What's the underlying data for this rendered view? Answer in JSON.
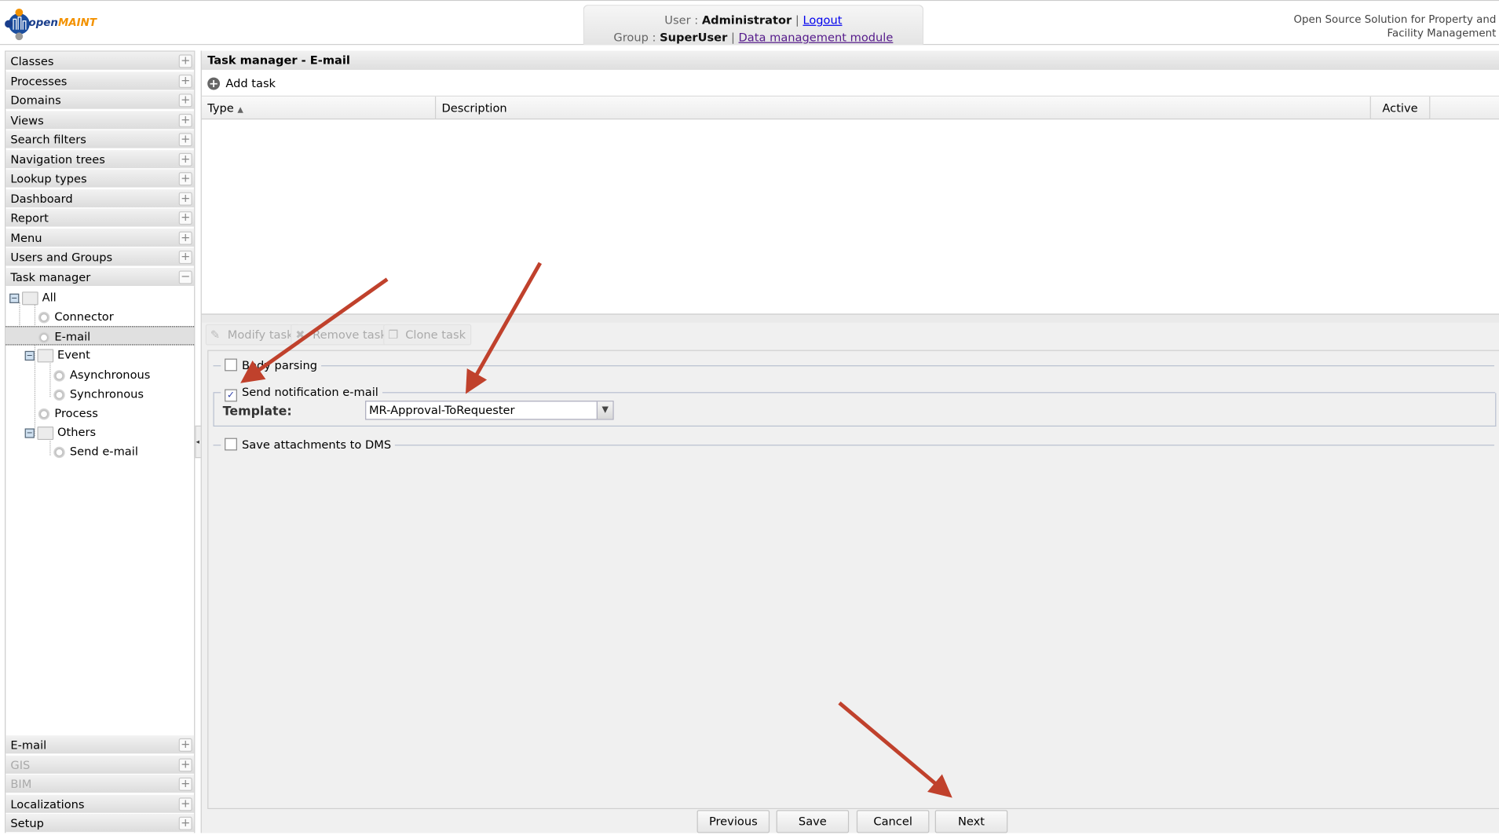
{
  "header": {
    "logo_text": "openMAINT",
    "user_label": "User :",
    "user_name": "Administrator",
    "logout": "Logout",
    "group_label": "Group :",
    "group_name": "SuperUser",
    "module_link": "Data management module",
    "separator": "|",
    "tagline_line1": "Open Source Solution for Property and",
    "tagline_line2": "Facility Management"
  },
  "sidebar": {
    "top_sections": [
      {
        "label": "Classes",
        "toggle": "+"
      },
      {
        "label": "Processes",
        "toggle": "+"
      },
      {
        "label": "Domains",
        "toggle": "+"
      },
      {
        "label": "Views",
        "toggle": "+"
      },
      {
        "label": "Search filters",
        "toggle": "+"
      },
      {
        "label": "Navigation trees",
        "toggle": "+"
      },
      {
        "label": "Lookup types",
        "toggle": "+"
      },
      {
        "label": "Dashboard",
        "toggle": "+"
      },
      {
        "label": "Report",
        "toggle": "+"
      },
      {
        "label": "Menu",
        "toggle": "+"
      },
      {
        "label": "Users and Groups",
        "toggle": "+"
      },
      {
        "label": "Task manager",
        "toggle": "−"
      }
    ],
    "tree": [
      {
        "label": "All"
      },
      {
        "label": "Connector"
      },
      {
        "label": "E-mail"
      },
      {
        "label": "Event"
      },
      {
        "label": "Asynchronous"
      },
      {
        "label": "Synchronous"
      },
      {
        "label": "Process"
      },
      {
        "label": "Others"
      },
      {
        "label": "Send e-mail"
      }
    ],
    "bottom_sections": [
      {
        "label": "E-mail",
        "toggle": "+"
      },
      {
        "label": "GIS",
        "toggle": "+"
      },
      {
        "label": "BIM",
        "toggle": "+"
      },
      {
        "label": "Localizations",
        "toggle": "+"
      },
      {
        "label": "Setup",
        "toggle": "+"
      }
    ]
  },
  "main": {
    "title": "Task manager - E-mail",
    "add_task": "Add task",
    "columns": {
      "type": "Type",
      "sort_indicator": "▲",
      "description": "Description",
      "active": "Active"
    },
    "toolbar": {
      "modify": "Modify task",
      "remove": "Remove task",
      "clone": "Clone task"
    },
    "form": {
      "body_parsing": "Body parsing",
      "body_parsing_checked": false,
      "send_notification": "Send notification e-mail",
      "send_notification_checked": true,
      "template_label": "Template:",
      "template_value": "MR-Approval-ToRequester",
      "save_attachments": "Save attachments to DMS",
      "save_attachments_checked": false
    },
    "buttons": {
      "previous": "Previous",
      "save": "Save",
      "cancel": "Cancel",
      "next": "Next"
    }
  },
  "colors": {
    "annotation_arrow": "#c0412c",
    "logo_orange": "#f39200",
    "logo_blue": "#1a3e8c"
  }
}
